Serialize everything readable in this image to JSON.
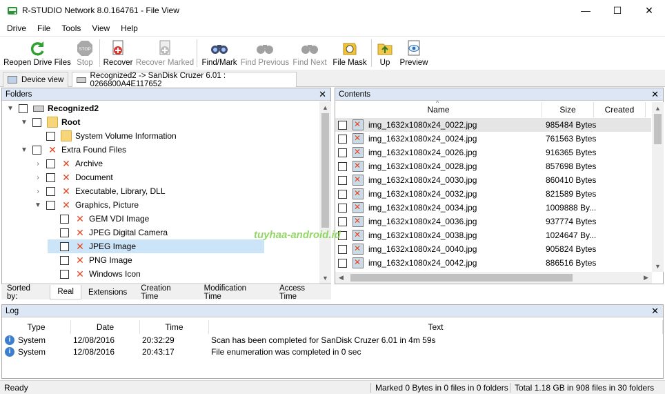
{
  "window": {
    "title": "R-STUDIO Network 8.0.164761 - File View",
    "minimize": "—",
    "maximize": "☐",
    "close": "✕"
  },
  "menu": [
    "Drive",
    "File",
    "Tools",
    "View",
    "Help"
  ],
  "toolbar": {
    "reopen": "Reopen Drive Files",
    "stop": "Stop",
    "recover": "Recover",
    "recover_marked": "Recover Marked",
    "find_mark": "Find/Mark",
    "find_previous": "Find Previous",
    "find_next": "Find Next",
    "file_mask": "File Mask",
    "up": "Up",
    "preview": "Preview"
  },
  "tabs": {
    "device_view": "Device view",
    "recognized": "Recognized2 -> SanDisk Cruzer 6.01 : 0266800A4E117652"
  },
  "folders": {
    "title": "Folders",
    "close": "✕",
    "items": [
      {
        "label": "Recognized2",
        "exp": "▼"
      },
      {
        "label": "Root",
        "exp": "▼"
      },
      {
        "label": "System Volume Information",
        "exp": ""
      },
      {
        "label": "Extra Found Files",
        "exp": "▼"
      },
      {
        "label": "Archive",
        "exp": "›"
      },
      {
        "label": "Document",
        "exp": "›"
      },
      {
        "label": "Executable, Library, DLL",
        "exp": "›"
      },
      {
        "label": "Graphics, Picture",
        "exp": "▼"
      },
      {
        "label": "GEM VDI Image",
        "exp": ""
      },
      {
        "label": "JPEG Digital Camera",
        "exp": ""
      },
      {
        "label": "JPEG Image",
        "exp": ""
      },
      {
        "label": "PNG Image",
        "exp": ""
      },
      {
        "label": "Windows Icon",
        "exp": ""
      }
    ]
  },
  "contents": {
    "title": "Contents",
    "close": "✕",
    "columns": {
      "name": "Name",
      "size": "Size",
      "created": "Created"
    },
    "rows": [
      {
        "name": "img_1632x1080x24_0022.jpg",
        "size": "985484 Bytes"
      },
      {
        "name": "img_1632x1080x24_0024.jpg",
        "size": "761563 Bytes"
      },
      {
        "name": "img_1632x1080x24_0026.jpg",
        "size": "916365 Bytes"
      },
      {
        "name": "img_1632x1080x24_0028.jpg",
        "size": "857698 Bytes"
      },
      {
        "name": "img_1632x1080x24_0030.jpg",
        "size": "860410 Bytes"
      },
      {
        "name": "img_1632x1080x24_0032.jpg",
        "size": "821589 Bytes"
      },
      {
        "name": "img_1632x1080x24_0034.jpg",
        "size": "1009888 By..."
      },
      {
        "name": "img_1632x1080x24_0036.jpg",
        "size": "937774 Bytes"
      },
      {
        "name": "img_1632x1080x24_0038.jpg",
        "size": "1024647 By..."
      },
      {
        "name": "img_1632x1080x24_0040.jpg",
        "size": "905824 Bytes"
      },
      {
        "name": "img_1632x1080x24_0042.jpg",
        "size": "886516 Bytes"
      }
    ]
  },
  "sort": {
    "label": "Sorted by:",
    "tabs": [
      "Real",
      "Extensions",
      "Creation Time",
      "Modification Time",
      "Access Time"
    ]
  },
  "log": {
    "title": "Log",
    "close": "✕",
    "columns": {
      "type": "Type",
      "date": "Date",
      "time": "Time",
      "text": "Text"
    },
    "rows": [
      {
        "type": "System",
        "date": "12/08/2016",
        "time": "20:32:29",
        "text": "Scan has been completed for SanDisk Cruzer 6.01 in 4m 59s"
      },
      {
        "type": "System",
        "date": "12/08/2016",
        "time": "20:43:17",
        "text": "File enumeration was completed in 0 sec"
      }
    ]
  },
  "status": {
    "ready": "Ready",
    "marked": "Marked 0 Bytes in 0 files in 0 folders",
    "total": "Total 1.18 GB in 908 files in 30 folders"
  },
  "watermark": "tuyhaa-android.id"
}
